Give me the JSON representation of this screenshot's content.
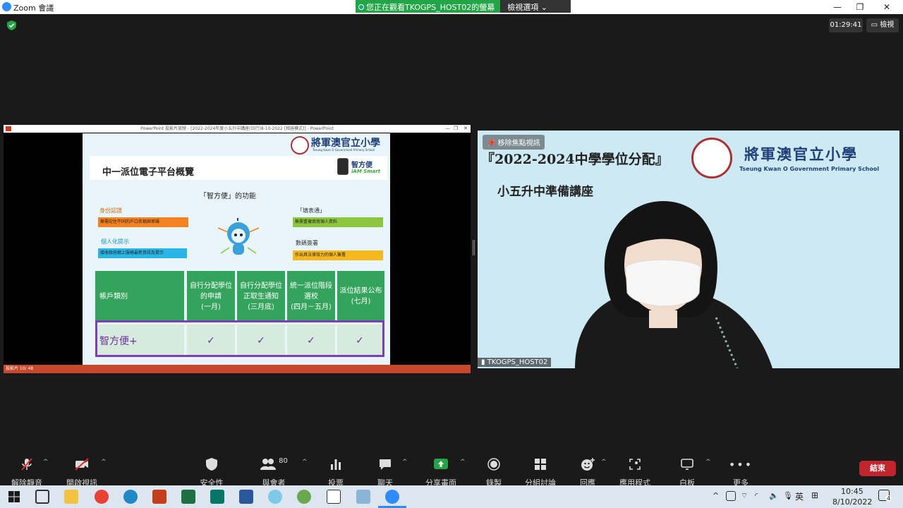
{
  "window": {
    "app_title": "Zoom 會議",
    "viewing_notice": "您正在觀看TKOGPS_HOST02的螢幕",
    "view_options": "檢視選項",
    "timer": "01:29:41",
    "view_button": "檢視"
  },
  "presentation": {
    "window_title": "PowerPoint 投影片放映 - [2022-2024年度小五升中講座(日行)8-10-2022 [相容模式]] - PowerPoint",
    "status": "投影片 10/ 48",
    "school_name": "將軍澳官立小學",
    "school_en": "Tseung Kwan O Government Primary School",
    "title": "中一派位電子平台概覽",
    "app_logo_name": "智方便",
    "app_logo_sub": "iAM Smart",
    "functions_heading": "「智方便」的功能",
    "features": [
      {
        "label": "身份認證",
        "desc": "無需記住不同的戶口名稱與密碼",
        "color": "#f58220"
      },
      {
        "label": "個人化提示",
        "desc": "接收政府網上服務最新資訊及提示",
        "color": "#29b6e6"
      },
      {
        "label": "「填表通」",
        "desc": "無需重複填寫個人資料",
        "color": "#8cc63f"
      },
      {
        "label": "數碼簽署",
        "desc": "作出具法律效力的個人簽署",
        "color": "#f7b81f"
      }
    ],
    "table": {
      "headers": [
        "帳戶類別",
        "自行分配學位的申請(一月)",
        "自行分配學位正取生通知(三月底)",
        "統一派位階段選校(四月－五月)",
        "派位結果公布(七月)"
      ],
      "header_lines": [
        [
          "帳戶類別"
        ],
        [
          "自行分配學位",
          "的申請",
          "(一月)"
        ],
        [
          "自行分配學位",
          "正取生通知",
          "(三月底)"
        ],
        [
          "統一派位階段",
          "選校",
          "(四月－五月)"
        ],
        [
          "派位結果公布",
          "(七月)"
        ]
      ],
      "row": [
        "智方便+",
        "✓",
        "✓",
        "✓",
        "✓"
      ]
    }
  },
  "speaker": {
    "unpin_label": "移除焦點視訊",
    "banner_line1": "『2022-2024中學學位分配』",
    "banner_line2": "小五升中準備講座",
    "school_name": "將軍澳官立小學",
    "school_en": "Tseung Kwan O Government Primary School",
    "participant_name": "TKOGPS_HOST02"
  },
  "toolbar": {
    "unmute": "解除靜音",
    "start_video": "開啟視訊",
    "security": "安全性",
    "participants": "與會者",
    "participant_count": "80",
    "polls": "投票",
    "chat": "聊天",
    "share_screen": "分享畫面",
    "record": "錄製",
    "breakout": "分組討論",
    "reactions": "回應",
    "apps": "應用程式",
    "whiteboard": "白板",
    "more": "更多",
    "end": "結束",
    "accent_share": "#23a547",
    "accent_end": "#c2242e"
  },
  "taskbar": {
    "ime": "英",
    "time": "10:45",
    "date": "8/10/2022",
    "notifications": "4"
  }
}
